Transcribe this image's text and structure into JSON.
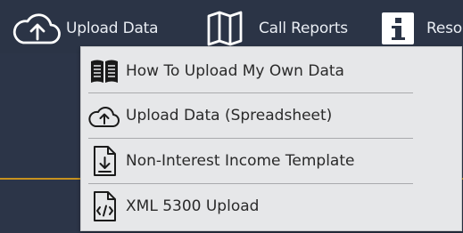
{
  "nav": {
    "upload_label": "Upload Data",
    "call_reports_label": "Call Reports",
    "resources_label": "Reso"
  },
  "menu": {
    "items": [
      {
        "label": "How To Upload My Own Data",
        "icon": "book-icon"
      },
      {
        "label": "Upload Data (Spreadsheet)",
        "icon": "cloud-upload-icon"
      },
      {
        "label": "Non-Interest Income Template",
        "icon": "file-download-icon"
      },
      {
        "label": "XML 5300 Upload",
        "icon": "file-code-icon"
      }
    ]
  },
  "colors": {
    "nav_background": "#2b3446",
    "menu_background": "#e6e7e9",
    "accent_line": "#c7921f"
  }
}
